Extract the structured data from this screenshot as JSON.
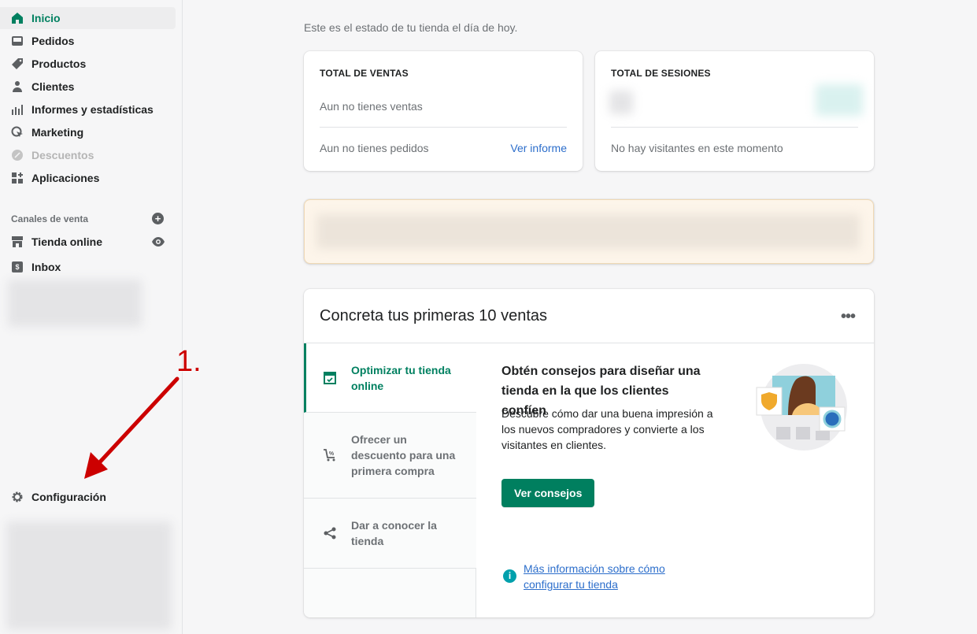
{
  "sidebar": {
    "items": [
      {
        "label": "Inicio",
        "icon": "home-icon",
        "active": true
      },
      {
        "label": "Pedidos",
        "icon": "inbox-icon"
      },
      {
        "label": "Productos",
        "icon": "tag-icon"
      },
      {
        "label": "Clientes",
        "icon": "person-icon"
      },
      {
        "label": "Informes y estadísticas",
        "icon": "bar-chart-icon"
      },
      {
        "label": "Marketing",
        "icon": "target-icon"
      },
      {
        "label": "Descuentos",
        "icon": "discount-icon",
        "disabled": true
      },
      {
        "label": "Aplicaciones",
        "icon": "apps-icon"
      }
    ],
    "sales_channels_label": "Canales de venta",
    "channels": [
      {
        "label": "Tienda online",
        "icon": "store-icon"
      },
      {
        "label": "Inbox",
        "icon": "inbox-chat-icon"
      }
    ],
    "settings_label": "Configuración"
  },
  "annotation": {
    "label": "1.",
    "color": "#cc0000"
  },
  "main": {
    "subtitle": "Este es el estado de tu tienda el día de hoy.",
    "sales_card": {
      "title": "TOTAL DE VENTAS",
      "no_sales": "Aun no tienes ventas",
      "no_orders": "Aun no tienes pedidos",
      "link": "Ver informe"
    },
    "sessions_card": {
      "title": "TOTAL DE SESIONES",
      "no_visitors": "No hay visitantes en este momento"
    },
    "guide": {
      "title": "Concreta tus primeras 10 ventas",
      "tabs": [
        {
          "label": "Optimizar tu tienda online",
          "icon": "store-check-icon",
          "active": true
        },
        {
          "label": "Ofrecer un descuento para una primera compra",
          "icon": "cart-discount-icon"
        },
        {
          "label": "Dar a conocer la tienda",
          "icon": "share-icon"
        }
      ],
      "heading": "Obtén consejos para diseñar una tienda en la que los clientes confíen",
      "body": "Descubre cómo dar una buena impresión a los nuevos compradores y convierte a los visitantes en clientes.",
      "button": "Ver consejos",
      "help_link": "Más información sobre cómo configurar tu tienda"
    }
  },
  "colors": {
    "accent": "#008060",
    "link": "#2c6ecb",
    "button": "#007f5f"
  }
}
